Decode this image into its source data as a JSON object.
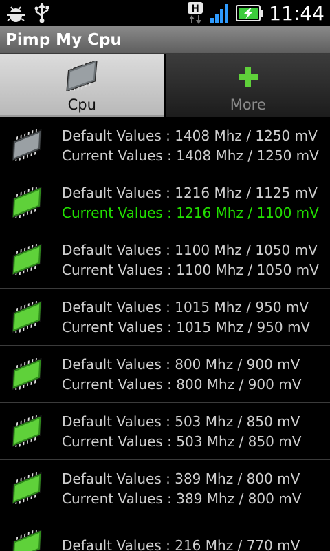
{
  "status_bar": {
    "time": "11:44",
    "icons": [
      "debug-bug-icon",
      "usb-icon",
      "h-data-icon",
      "signal-icon",
      "battery-charging-icon"
    ],
    "h_label": "H"
  },
  "app": {
    "title": "Pimp My Cpu"
  },
  "tabs": [
    {
      "label": "Cpu",
      "icon": "cpu-chip-icon",
      "selected": true
    },
    {
      "label": "More",
      "icon": "plus-icon",
      "selected": false
    }
  ],
  "colors": {
    "chip_gray": "#9aa0a4",
    "chip_green": "#5fd13a",
    "active_text": "#22e000"
  },
  "rows": [
    {
      "chip": "gray",
      "default": "Default Values : 1408 Mhz / 1250 mV",
      "current": "Current Values : 1408 Mhz / 1250 mV",
      "active": false
    },
    {
      "chip": "green",
      "default": "Default Values : 1216 Mhz / 1125 mV",
      "current": "Current Values : 1216 Mhz / 1100 mV",
      "active": true
    },
    {
      "chip": "green",
      "default": "Default Values : 1100 Mhz / 1050 mV",
      "current": "Current Values : 1100 Mhz / 1050 mV",
      "active": false
    },
    {
      "chip": "green",
      "default": "Default Values : 1015 Mhz / 950 mV",
      "current": "Current Values : 1015 Mhz / 950 mV",
      "active": false
    },
    {
      "chip": "green",
      "default": "Default Values : 800 Mhz / 900 mV",
      "current": "Current Values : 800 Mhz / 900 mV",
      "active": false
    },
    {
      "chip": "green",
      "default": "Default Values : 503 Mhz / 850 mV",
      "current": "Current Values : 503 Mhz / 850 mV",
      "active": false
    },
    {
      "chip": "green",
      "default": "Default Values : 389 Mhz / 800 mV",
      "current": "Current Values : 389 Mhz / 800 mV",
      "active": false
    },
    {
      "chip": "green",
      "default": "Default Values : 216 Mhz / 770 mV",
      "current": "",
      "active": false
    }
  ]
}
